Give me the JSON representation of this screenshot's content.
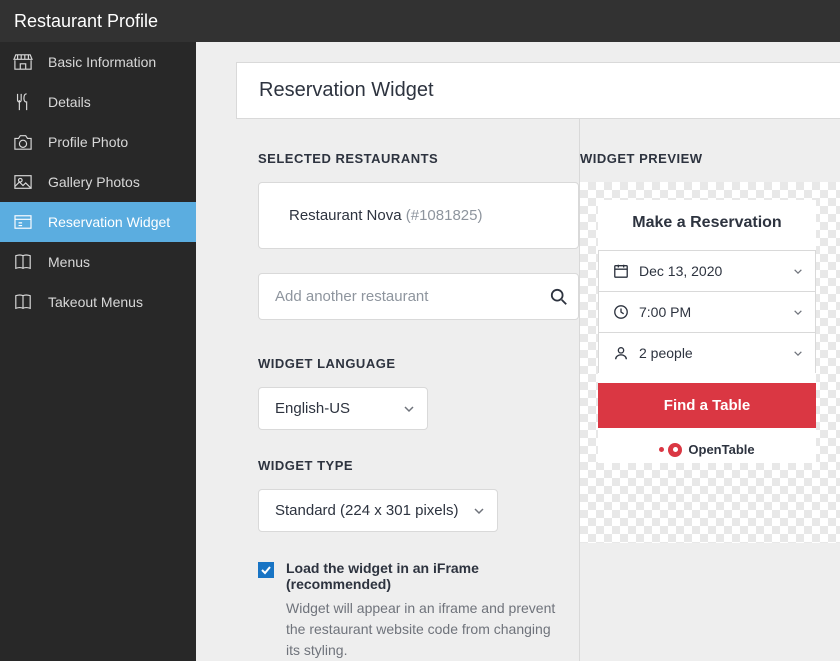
{
  "title": "Restaurant Profile",
  "sidebar": {
    "items": [
      {
        "label": "Basic Information"
      },
      {
        "label": "Details"
      },
      {
        "label": "Profile Photo"
      },
      {
        "label": "Gallery Photos"
      },
      {
        "label": "Reservation Widget"
      },
      {
        "label": "Menus"
      },
      {
        "label": "Takeout Menus"
      }
    ]
  },
  "panel": {
    "title": "Reservation Widget",
    "selected_label": "SELECTED RESTAURANTS",
    "selected_name": "Restaurant Nova ",
    "selected_id": "(#1081825)",
    "search_placeholder": "Add another restaurant",
    "lang_label": "WIDGET LANGUAGE",
    "lang_value": "English-US",
    "type_label": "WIDGET TYPE",
    "type_value": "Standard (224 x 301 pixels)",
    "iframe_label": "Load the widget in an iFrame (recommended)",
    "iframe_desc": "Widget will appear in an iframe and prevent the restaurant website code from changing its styling."
  },
  "preview": {
    "label": "WIDGET PREVIEW",
    "title": "Make a Reservation",
    "date": "Dec 13, 2020",
    "time": "7:00 PM",
    "people": "2 people",
    "button": "Find a Table",
    "powered_by": "OpenTable"
  }
}
